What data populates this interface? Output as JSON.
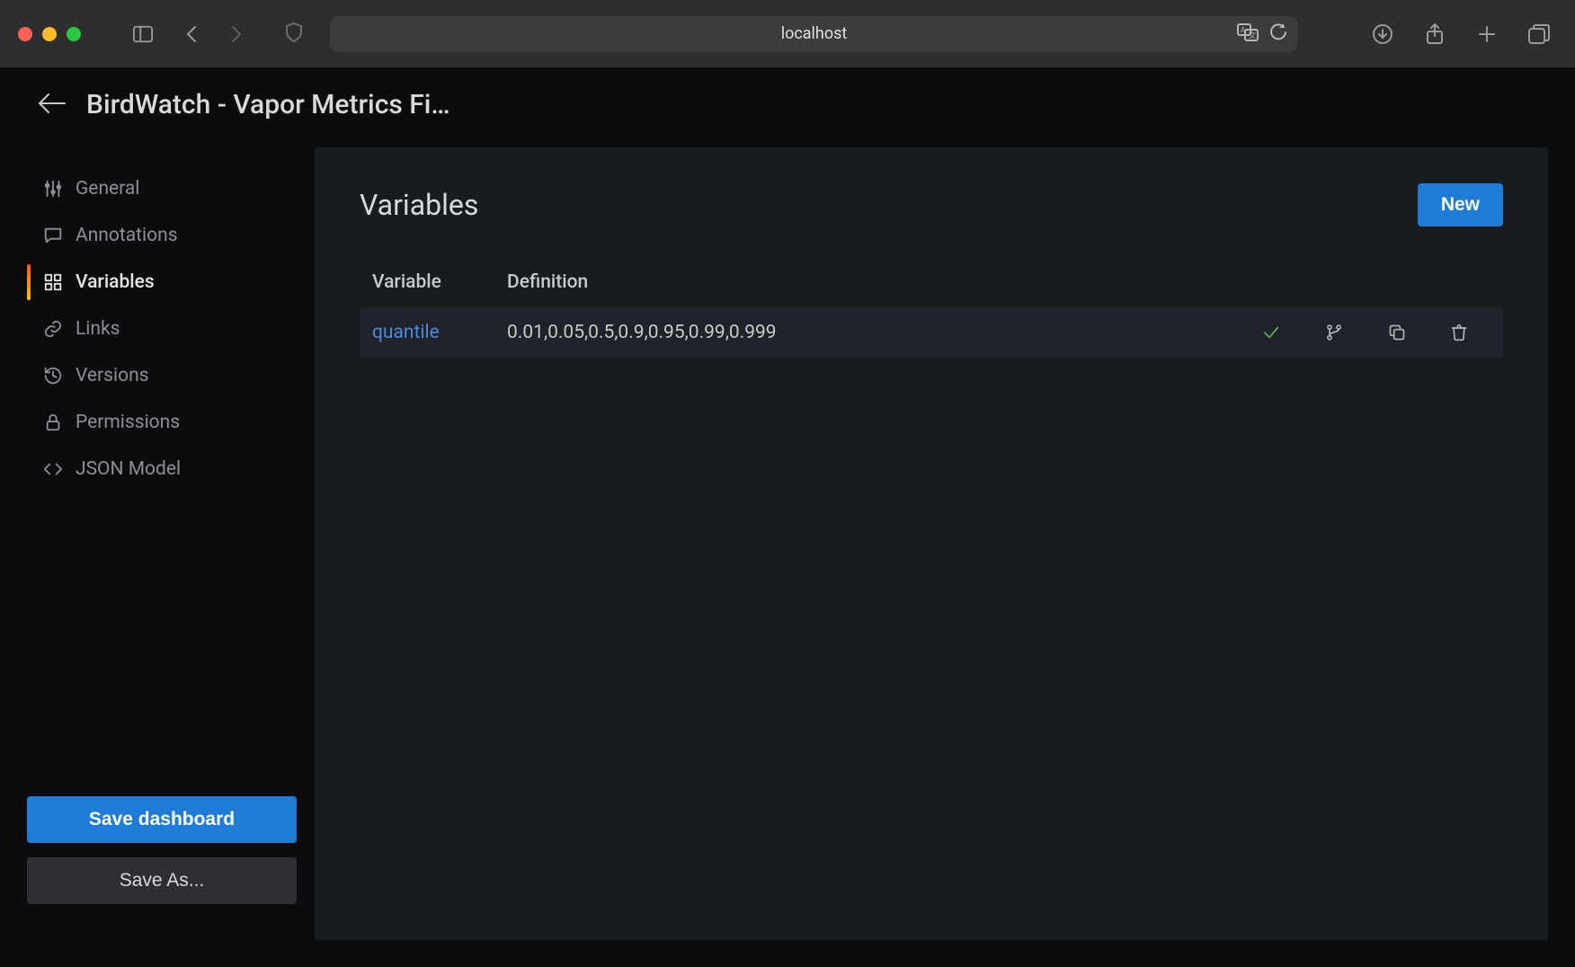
{
  "browser": {
    "url": "localhost"
  },
  "header": {
    "title": "BirdWatch - Vapor Metrics Fi…"
  },
  "sidebar": {
    "items": [
      {
        "label": "General",
        "icon": "sliders-icon"
      },
      {
        "label": "Annotations",
        "icon": "comment-icon"
      },
      {
        "label": "Variables",
        "icon": "grid-icon",
        "active": true
      },
      {
        "label": "Links",
        "icon": "link-icon"
      },
      {
        "label": "Versions",
        "icon": "history-icon"
      },
      {
        "label": "Permissions",
        "icon": "lock-icon"
      },
      {
        "label": "JSON Model",
        "icon": "code-icon"
      }
    ],
    "save_label": "Save dashboard",
    "save_as_label": "Save As..."
  },
  "panel": {
    "title": "Variables",
    "new_label": "New",
    "columns": {
      "variable": "Variable",
      "definition": "Definition"
    },
    "rows": [
      {
        "name": "quantile",
        "definition": "0.01,0.05,0.5,0.9,0.95,0.99,0.999"
      }
    ]
  }
}
